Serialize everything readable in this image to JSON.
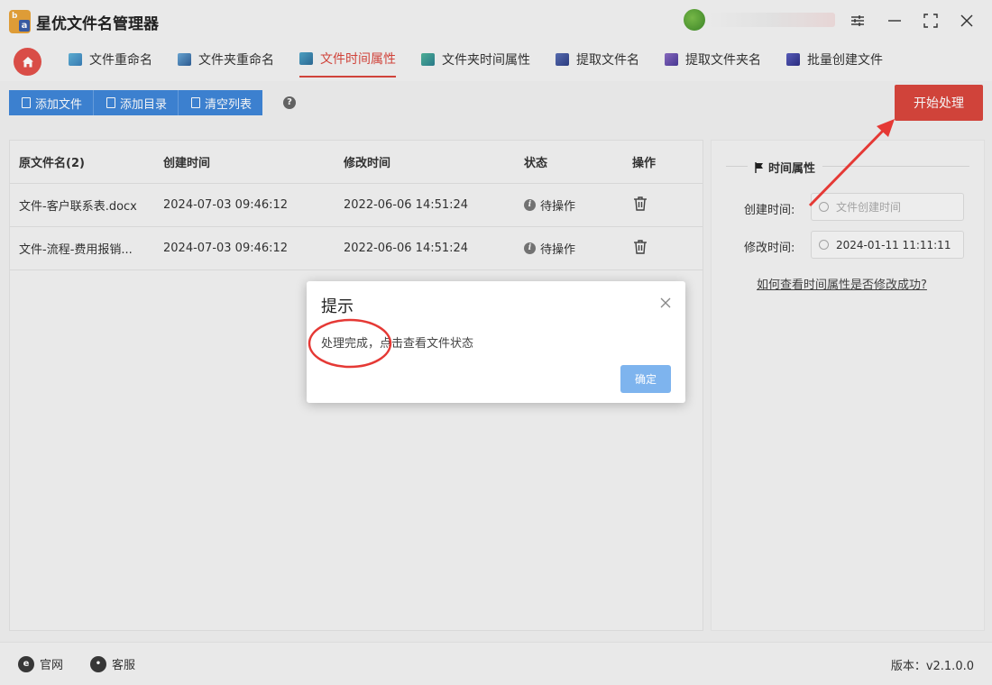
{
  "app": {
    "title": "星优文件名管理器"
  },
  "nav": {
    "tabs": [
      {
        "label": "文件重命名"
      },
      {
        "label": "文件夹重命名"
      },
      {
        "label": "文件时间属性"
      },
      {
        "label": "文件夹时间属性"
      },
      {
        "label": "提取文件名"
      },
      {
        "label": "提取文件夹名"
      },
      {
        "label": "批量创建文件"
      }
    ],
    "active_tab": "文件时间属性"
  },
  "toolbar": {
    "add_file": "添加文件",
    "add_dir": "添加目录",
    "clear_list": "清空列表",
    "help": "?",
    "start": "开始处理"
  },
  "table": {
    "headers": [
      "原文件名(2)",
      "创建时间",
      "修改时间",
      "状态",
      "操作"
    ],
    "rows": [
      {
        "name": "文件-客户联系表.docx",
        "created": "2024-07-03 09:46:12",
        "modified": "2022-06-06 14:51:24",
        "status": "待操作"
      },
      {
        "name": "文件-流程-费用报销...",
        "created": "2024-07-03 09:46:12",
        "modified": "2022-06-06 14:51:24",
        "status": "待操作"
      }
    ]
  },
  "side": {
    "title": "时间属性",
    "created_label": "创建时间:",
    "created_placeholder": "文件创建时间",
    "modified_label": "修改时间:",
    "modified_value": "2024-01-11 11:11:11",
    "help_link": "如何查看时间属性是否修改成功?"
  },
  "dialog": {
    "title": "提示",
    "message": "处理完成，点击查看文件状态",
    "ok": "确定"
  },
  "footer": {
    "website": "官网",
    "support": "客服",
    "version": "版本：v2.1.0.0"
  },
  "colors": {
    "accent_red": "#d9463d",
    "toolbar_blue": "#3f86d8",
    "ok_blue": "#7eb4ee",
    "annotation_red": "#e53935"
  }
}
